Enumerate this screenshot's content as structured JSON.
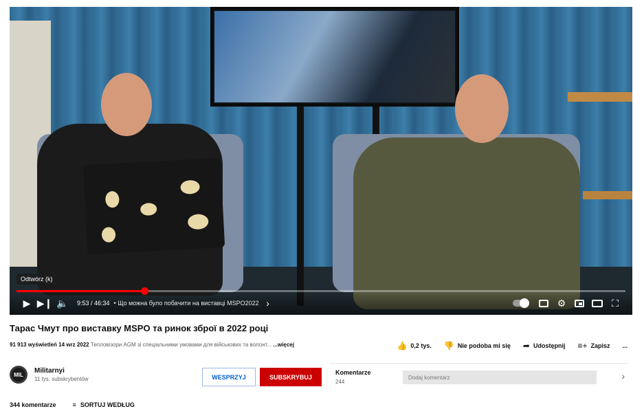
{
  "player": {
    "tooltip": "Odtwórz (k)",
    "time": "9:53 / 46:34",
    "chapter": "• Що можна було побачити на виставці MSPO2022",
    "progress_percent": 21
  },
  "video": {
    "title": "Тарас Чмут про виставку MSPO та ринок зброї в 2022 році",
    "views_date": "91 913 wyświetleń  14 wrz 2022",
    "description": "Тепловізори AGM зі спеціальними умовами для військових та волонт...",
    "more": "...więcej"
  },
  "actions": {
    "like": "0,2 tys.",
    "dislike": "Nie podoba mi się",
    "share": "Udostępnij",
    "save": "Zapisz",
    "more": "..."
  },
  "channel": {
    "avatar_text": "MIL",
    "name": "Militarnyi",
    "subs": "11 tys. subskrybentów",
    "support": "WESPRZYJ",
    "subscribe": "SUBSKRYBUJ"
  },
  "comments": {
    "label": "Komentarze",
    "count": "244",
    "placeholder": "Dodaj komentarz",
    "total": "344 komentarze",
    "sort": "SORTUJ WEDŁUG"
  },
  "colors": {
    "accent": "#ff0000",
    "subscribe": "#cc0000",
    "link": "#065fd4"
  }
}
